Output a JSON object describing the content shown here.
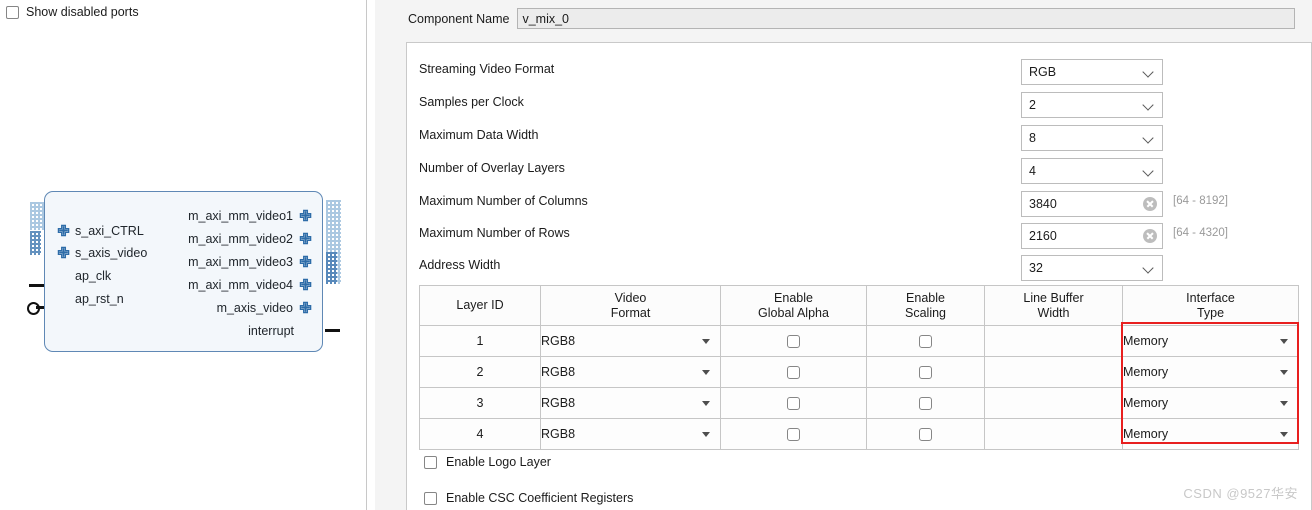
{
  "left": {
    "show_disabled_ports": "Show disabled ports",
    "block": {
      "left_ports": [
        {
          "label": "s_axi_CTRL",
          "marker": "plus"
        },
        {
          "label": "s_axis_video",
          "marker": "plus"
        },
        {
          "label": "ap_clk",
          "marker": "none"
        },
        {
          "label": "ap_rst_n",
          "marker": "none"
        }
      ],
      "right_ports": [
        {
          "label": "m_axi_mm_video1",
          "marker": "plus"
        },
        {
          "label": "m_axi_mm_video2",
          "marker": "plus"
        },
        {
          "label": "m_axi_mm_video3",
          "marker": "plus"
        },
        {
          "label": "m_axi_mm_video4",
          "marker": "plus"
        },
        {
          "label": "m_axis_video",
          "marker": "plus"
        },
        {
          "label": "interrupt",
          "marker": "none"
        }
      ]
    }
  },
  "header": {
    "component_name_label": "Component Name",
    "component_name_value": "v_mix_0"
  },
  "fields": [
    {
      "label": "Streaming Video Format",
      "type": "combo",
      "value": "RGB",
      "hint": ""
    },
    {
      "label": "Samples per Clock",
      "type": "combo",
      "value": "2",
      "hint": ""
    },
    {
      "label": "Maximum Data Width",
      "type": "combo",
      "value": "8",
      "hint": ""
    },
    {
      "label": "Number of Overlay Layers",
      "type": "combo",
      "value": "4",
      "hint": ""
    },
    {
      "label": "Maximum Number of Columns",
      "type": "text",
      "value": "3840",
      "hint": "[64 - 8192]"
    },
    {
      "label": "Maximum Number of Rows",
      "type": "text",
      "value": "2160",
      "hint": "[64 - 4320]"
    },
    {
      "label": "Address Width",
      "type": "combo",
      "value": "32",
      "hint": ""
    }
  ],
  "table": {
    "columns": [
      {
        "line1": "Layer ID",
        "line2": ""
      },
      {
        "line1": "Video",
        "line2": "Format"
      },
      {
        "line1": "Enable",
        "line2": "Global Alpha"
      },
      {
        "line1": "Enable",
        "line2": "Scaling"
      },
      {
        "line1": "Line Buffer",
        "line2": "Width"
      },
      {
        "line1": "Interface",
        "line2": "Type"
      }
    ],
    "rows": [
      {
        "layer_id": "1",
        "video_format": "RGB8",
        "global_alpha": false,
        "scaling": false,
        "line_buffer_width": "",
        "interface_type": "Memory"
      },
      {
        "layer_id": "2",
        "video_format": "RGB8",
        "global_alpha": false,
        "scaling": false,
        "line_buffer_width": "",
        "interface_type": "Memory"
      },
      {
        "layer_id": "3",
        "video_format": "RGB8",
        "global_alpha": false,
        "scaling": false,
        "line_buffer_width": "",
        "interface_type": "Memory"
      },
      {
        "layer_id": "4",
        "video_format": "RGB8",
        "global_alpha": false,
        "scaling": false,
        "line_buffer_width": "",
        "interface_type": "Memory"
      }
    ],
    "highlight_color": "#e81f1f"
  },
  "bottom_checks": [
    {
      "label": "Enable Logo Layer",
      "checked": false
    },
    {
      "label": "Enable CSC Coefficient Registers",
      "checked": false
    }
  ],
  "watermark": "CSDN @9527华安"
}
